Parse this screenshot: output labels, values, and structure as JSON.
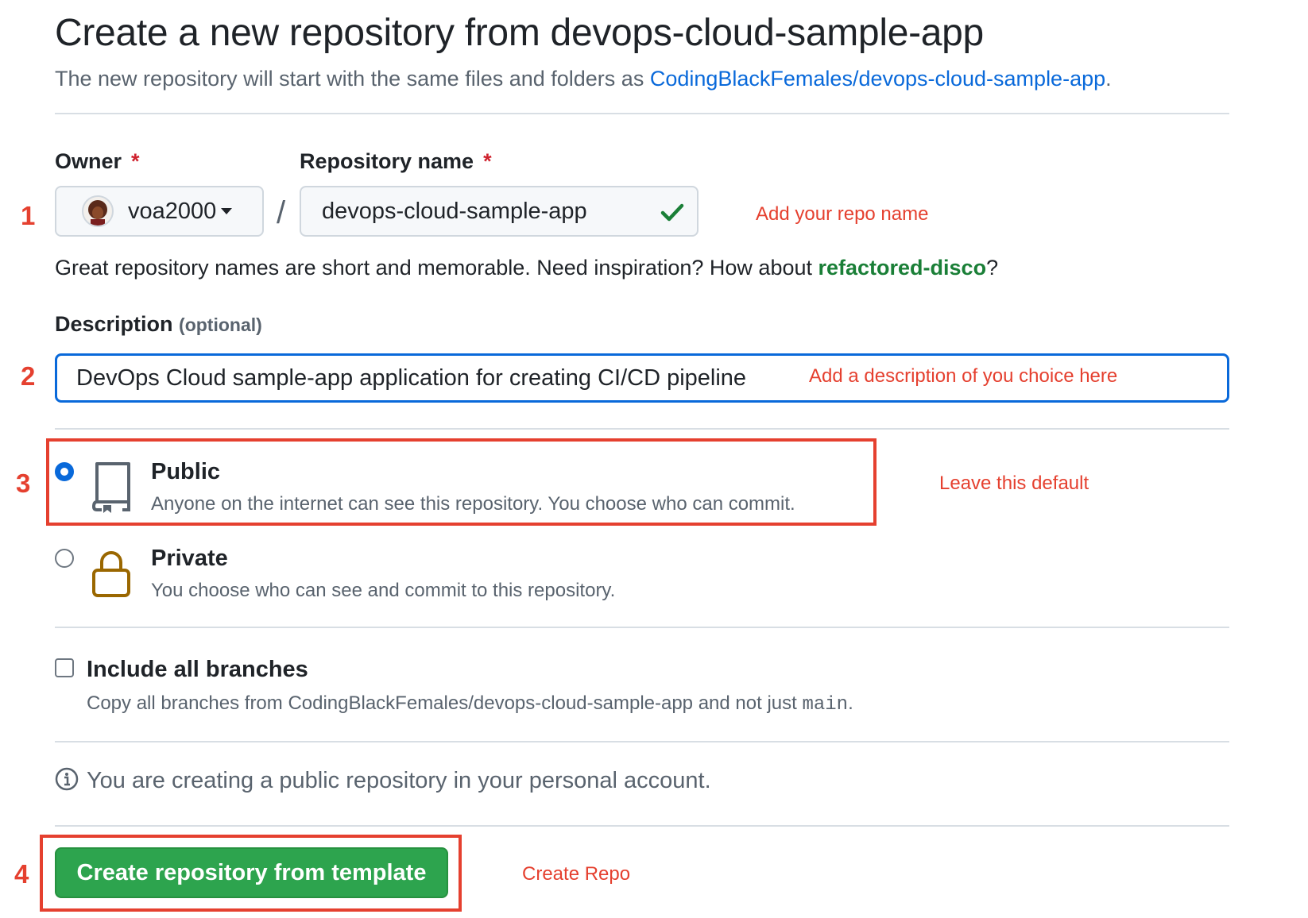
{
  "header": {
    "title": "Create a new repository from devops-cloud-sample-app",
    "subtitle_prefix": "The new repository will start with the same files and folders as ",
    "template_link": "CodingBlackFemales/devops-cloud-sample-app",
    "subtitle_suffix": "."
  },
  "owner": {
    "label": "Owner",
    "required_mark": "*",
    "value": "voa2000"
  },
  "repo_name": {
    "label": "Repository name",
    "required_mark": "*",
    "value": "devops-cloud-sample-app",
    "hint_prefix": "Great repository names are short and memorable. Need inspiration? How about ",
    "hint_suggestion": "refactored-disco",
    "hint_suffix": "?"
  },
  "slash": "/",
  "description": {
    "label": "Description",
    "optional": "(optional)",
    "value": "DevOps Cloud sample-app application for creating CI/CD pipeline"
  },
  "visibility": {
    "public": {
      "title": "Public",
      "desc": "Anyone on the internet can see this repository. You choose who can commit.",
      "selected": true
    },
    "private": {
      "title": "Private",
      "desc": "You choose who can see and commit to this repository.",
      "selected": false
    }
  },
  "branches": {
    "label": "Include all branches",
    "desc_prefix": "Copy all branches from CodingBlackFemales/devops-cloud-sample-app and not just ",
    "desc_code": "main",
    "desc_suffix": ".",
    "checked": false
  },
  "notice": "You are creating a public repository in your personal account.",
  "create_button": "Create repository from template",
  "annotations": {
    "step1": "1",
    "step2": "2",
    "step3": "3",
    "step4": "4",
    "repo_name_note": "Add your repo name",
    "description_note": "Add a description of you choice here",
    "visibility_note": "Leave this default",
    "create_note": "Create Repo"
  },
  "colors": {
    "link": "#0969da",
    "suggestion_green": "#1a7f37",
    "button_green": "#2da44e",
    "annotation_red": "#e5402f",
    "focus_blue": "#0969da"
  },
  "icons": {
    "owner_caret": "caret-down-icon",
    "name_valid": "check-icon",
    "public": "repo-icon",
    "private": "lock-icon",
    "info": "info-icon"
  }
}
